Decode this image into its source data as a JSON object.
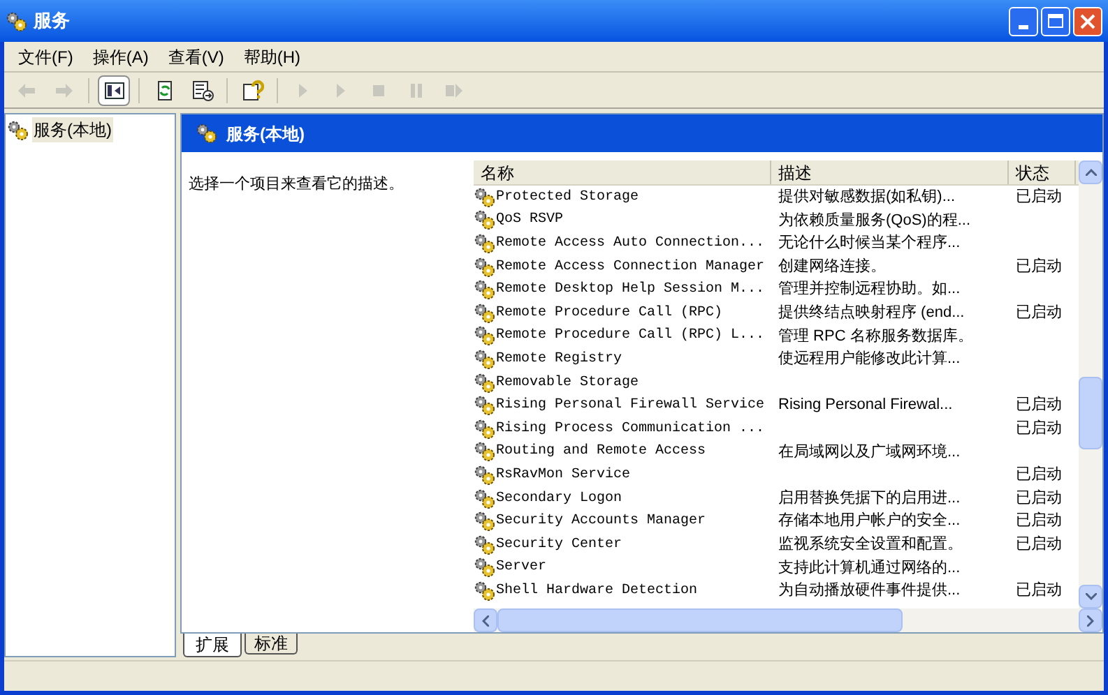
{
  "window": {
    "title": "服务"
  },
  "menu": [
    "文件(F)",
    "操作(A)",
    "查看(V)",
    "帮助(H)"
  ],
  "toolbar": [
    {
      "kind": "back",
      "disabled": true,
      "pressed": false
    },
    {
      "kind": "forward",
      "disabled": true,
      "pressed": false
    },
    {
      "kind": "tree",
      "disabled": false,
      "pressed": true
    },
    {
      "kind": "refresh",
      "disabled": false,
      "pressed": false
    },
    {
      "kind": "export",
      "disabled": false,
      "pressed": false
    },
    {
      "kind": "help",
      "disabled": false,
      "pressed": false
    },
    {
      "kind": "start",
      "disabled": true,
      "pressed": false
    },
    {
      "kind": "start",
      "disabled": true,
      "pressed": false
    },
    {
      "kind": "stop",
      "disabled": true,
      "pressed": false
    },
    {
      "kind": "pause",
      "disabled": true,
      "pressed": false
    },
    {
      "kind": "resume",
      "disabled": true,
      "pressed": false
    }
  ],
  "tree": {
    "items": [
      {
        "label": "服务(本地)",
        "selected": true
      }
    ]
  },
  "pane_header": {
    "title": "服务(本地)"
  },
  "description": "选择一个项目来查看它的描述。",
  "table": {
    "columns": [
      "名称",
      "描述",
      "状态"
    ],
    "rows": [
      {
        "name": "Protected Storage",
        "description": "提供对敏感数据(如私钥)...",
        "status": "已启动"
      },
      {
        "name": "QoS RSVP",
        "description": "为依赖质量服务(QoS)的程..."
      },
      {
        "name": "Remote Access Auto Connection...",
        "description": "无论什么时候当某个程序..."
      },
      {
        "name": "Remote Access Connection Manager",
        "description": "创建网络连接。",
        "status": "已启动"
      },
      {
        "name": "Remote Desktop Help Session M...",
        "description": "管理并控制远程协助。如..."
      },
      {
        "name": "Remote Procedure Call (RPC)",
        "description": "提供终结点映射程序 (end...",
        "status": "已启动"
      },
      {
        "name": "Remote Procedure Call (RPC) L...",
        "description": "管理 RPC 名称服务数据库。"
      },
      {
        "name": "Remote Registry",
        "description": "使远程用户能修改此计算..."
      },
      {
        "name": "Removable Storage"
      },
      {
        "name": "Rising Personal Firewall Service",
        "description": "Rising Personal Firewal...",
        "status": "已启动"
      },
      {
        "name": "Rising Process Communication ...",
        "status": "已启动"
      },
      {
        "name": "Routing and Remote Access",
        "description": "在局域网以及广域网环境..."
      },
      {
        "name": "RsRavMon Service",
        "status": "已启动"
      },
      {
        "name": "Secondary Logon",
        "description": "启用替换凭据下的启用进...",
        "status": "已启动"
      },
      {
        "name": "Security Accounts Manager",
        "description": "存储本地用户帐户的安全...",
        "status": "已启动"
      },
      {
        "name": "Security Center",
        "description": "监视系统安全设置和配置。",
        "status": "已启动"
      },
      {
        "name": "Server",
        "description": "支持此计算机通过网络的..."
      },
      {
        "name": "Shell Hardware Detection",
        "description": "为自动播放硬件事件提供...",
        "status": "已启动"
      }
    ]
  },
  "tabs": [
    {
      "label": "扩展",
      "selected": true
    },
    {
      "label": "标准",
      "selected": false
    }
  ]
}
